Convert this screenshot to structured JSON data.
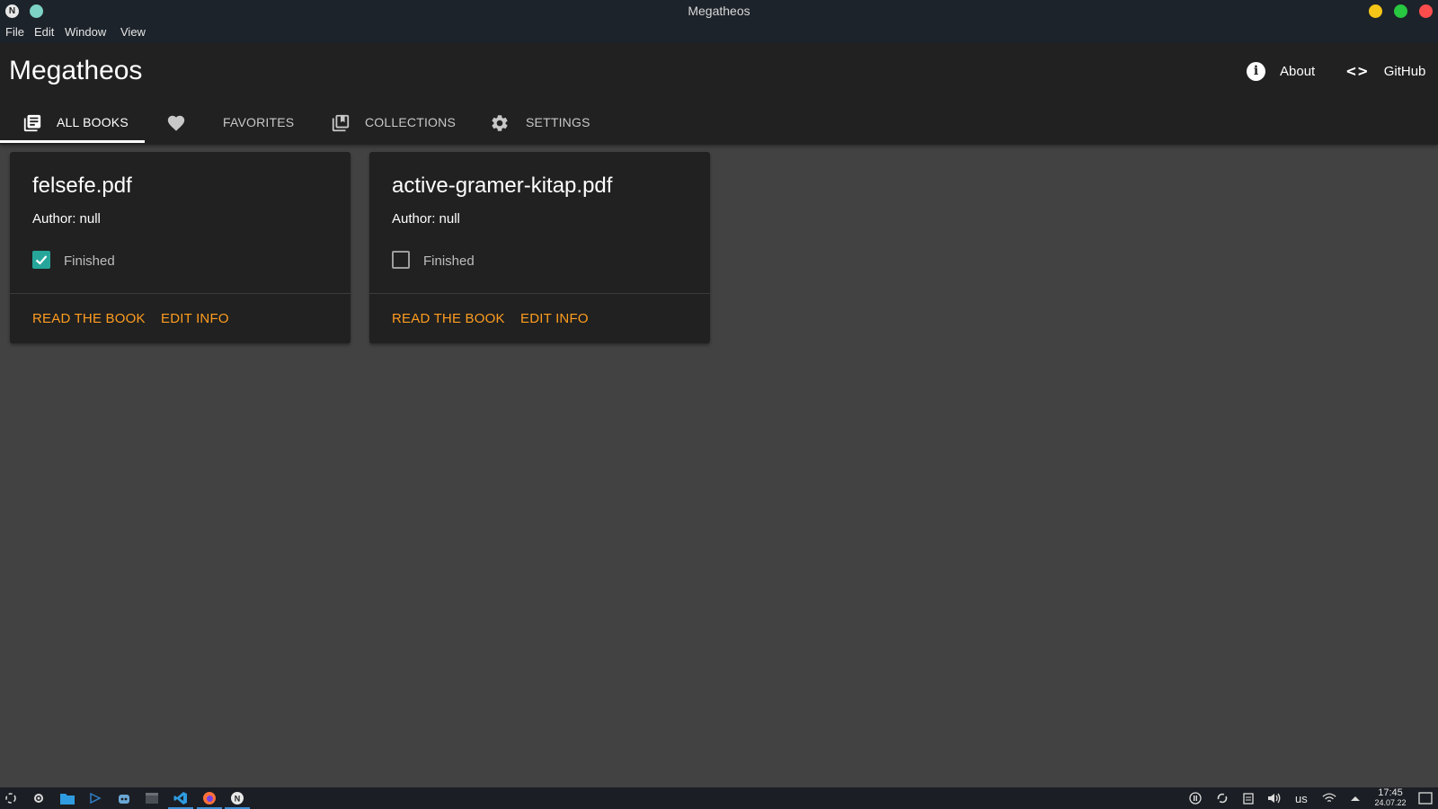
{
  "window": {
    "title": "Megatheos",
    "app_icon_glyph": "N"
  },
  "menu": {
    "items": [
      "File",
      "Edit",
      "Window",
      "View"
    ]
  },
  "header": {
    "app_title": "Megatheos",
    "links": {
      "about": "About",
      "github": "GitHub"
    }
  },
  "tabs": [
    {
      "label": "ALL BOOKS",
      "icon": "library-books-icon",
      "active": true
    },
    {
      "label": "FAVORITES",
      "icon": "heart-icon",
      "active": false
    },
    {
      "label": "COLLECTIONS",
      "icon": "collections-icon",
      "active": false
    },
    {
      "label": "SETTINGS",
      "icon": "gear-icon",
      "active": false
    }
  ],
  "books": [
    {
      "title": "felsefe.pdf",
      "author": "Author: null",
      "finished": true,
      "finished_label": "Finished",
      "read_label": "READ THE BOOK",
      "edit_label": "EDIT INFO"
    },
    {
      "title": "active-gramer-kitap.pdf",
      "author": "Author: null",
      "finished": false,
      "finished_label": "Finished",
      "read_label": "READ THE BOOK",
      "edit_label": "EDIT INFO"
    }
  ],
  "taskbar": {
    "keyboard_layout": "us",
    "time": "17:45",
    "date": "24.07.22"
  },
  "colors": {
    "accent": "#ff9d1f",
    "checkbox": "#26a69a",
    "background": "#424242",
    "surface": "#212121"
  }
}
